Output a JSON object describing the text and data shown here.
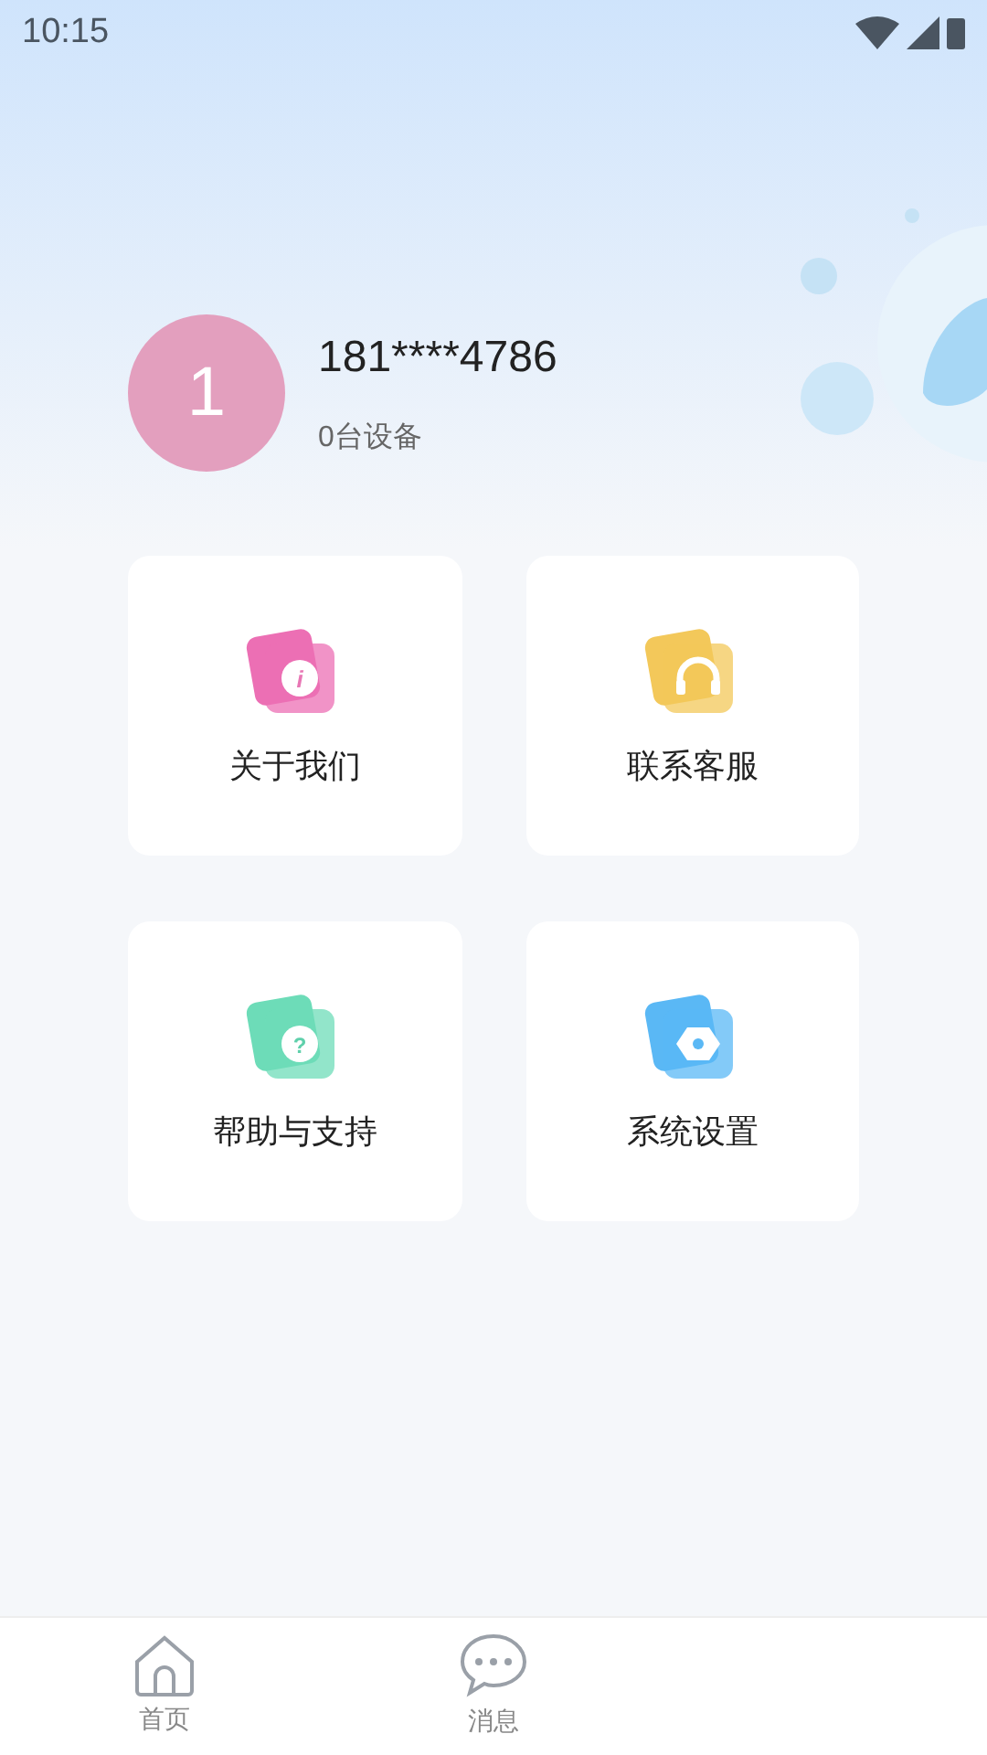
{
  "status_bar": {
    "time": "10:15"
  },
  "profile": {
    "avatar": "1",
    "phone": "181****4786",
    "devices": "0台设备"
  },
  "menu": [
    {
      "label": "关于我们",
      "kind": "info",
      "glyph": "i",
      "color": "#ec6fb4"
    },
    {
      "label": "联系客服",
      "kind": "headset",
      "color": "#f3c85a"
    },
    {
      "label": "帮助与支持",
      "kind": "help",
      "glyph": "?",
      "color": "#6ddcb8"
    },
    {
      "label": "系统设置",
      "kind": "settings",
      "color": "#5ab8f5"
    }
  ],
  "tabs": [
    {
      "label": "首页",
      "kind": "home",
      "selected": false
    },
    {
      "label": "消息",
      "kind": "chat",
      "selected": false
    }
  ]
}
